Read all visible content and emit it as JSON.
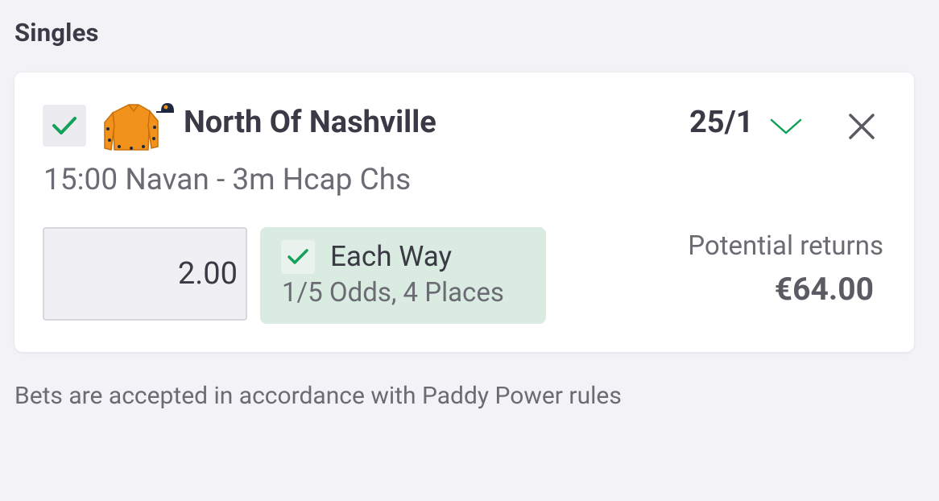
{
  "section": {
    "title": "Singles"
  },
  "bet": {
    "selected": true,
    "runner_name": "North Of Nashville",
    "odds": "25/1",
    "race": "15:00 Navan - 3m Hcap Chs",
    "stake": "2.00",
    "each_way": {
      "checked": true,
      "label": "Each Way",
      "terms": "1/5 Odds, 4 Places"
    },
    "potential_returns_label": "Potential returns",
    "potential_returns_value": "€64.00"
  },
  "footer": {
    "note": "Bets are accepted in accordance with Paddy Power rules"
  },
  "colors": {
    "accent_green": "#13a05a",
    "each_way_bg": "#daebe1",
    "silks_orange": "#f0921b",
    "silks_navy": "#1d2940"
  },
  "icons": {
    "select": "check-icon",
    "silks": "jockey-silks-icon",
    "odds_toggle": "chevron-down-icon",
    "remove": "close-icon",
    "each_way": "check-icon"
  }
}
